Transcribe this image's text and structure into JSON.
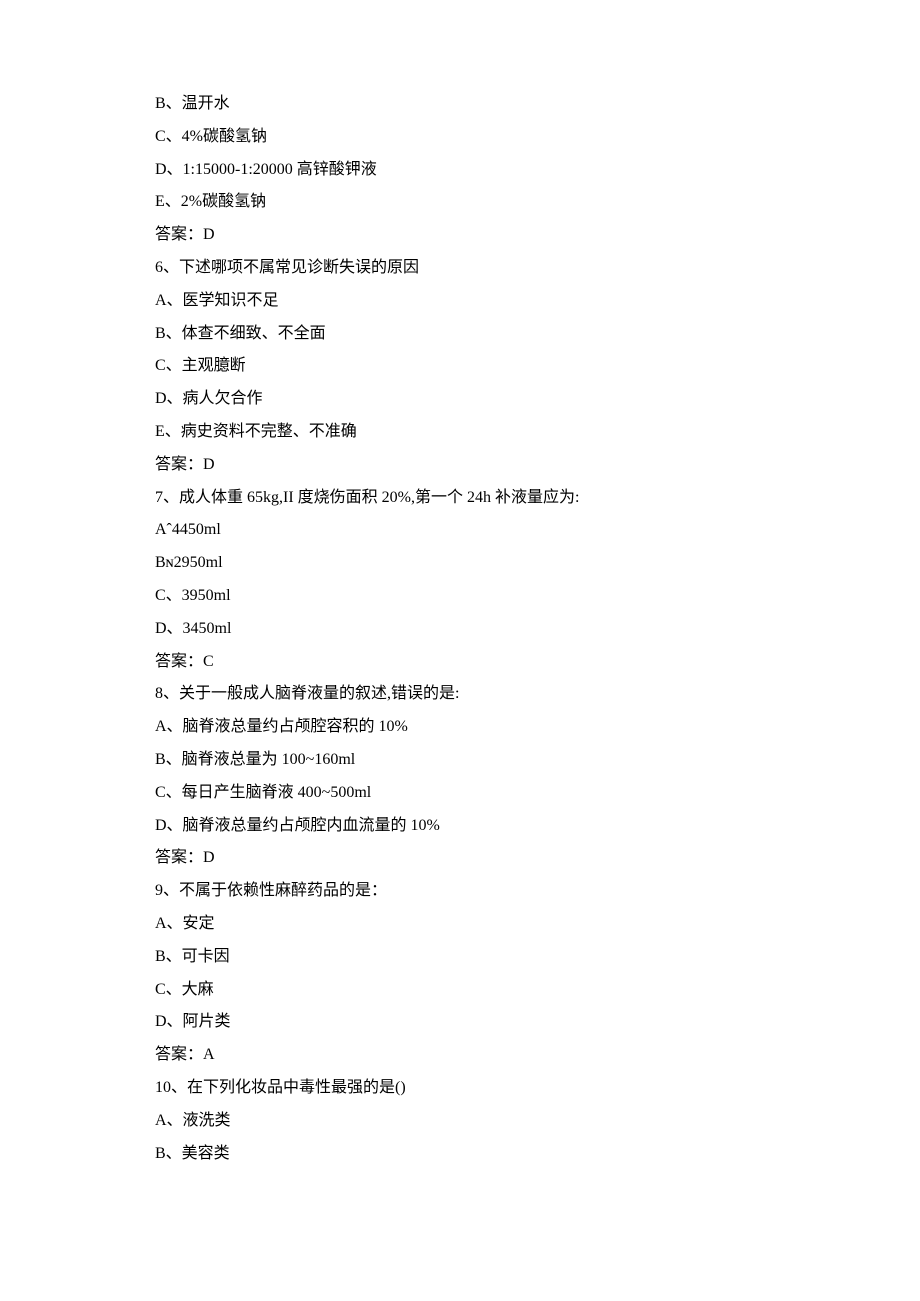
{
  "lines": [
    "B、温开水",
    "C、4%碳酸氢钠",
    "D、1:15000-1:20000 高锌酸钾液",
    "E、2%碳酸氢钠",
    "答案：D",
    "6、下述哪项不属常见诊断失误的原因",
    "A、医学知识不足",
    "B、体查不细致、不全面",
    "C、主观臆断",
    "D、病人欠合作",
    "E、病史资料不完整、不准确",
    "答案：D",
    "7、成人体重 65kg,II 度烧伤面积 20%,第一个 24h 补液量应为:",
    "Aˆ4450ml",
    "Bɴ2950ml",
    "C、3950ml",
    "D、3450ml",
    "答案：C",
    "8、关于一般成人脑脊液量的叙述,错误的是:",
    "A、脑脊液总量约占颅腔容积的 10%",
    "B、脑脊液总量为 100~160ml",
    "C、每日产生脑脊液 400~500ml",
    "D、脑脊液总量约占颅腔内血流量的 10%",
    "答案：D",
    "9、不属于依赖性麻醉药品的是：",
    "A、安定",
    "B、可卡因",
    "C、大麻",
    "D、阿片类",
    "答案：A",
    "10、在下列化妆品中毒性最强的是()",
    "A、液洗类",
    "B、美容类"
  ]
}
